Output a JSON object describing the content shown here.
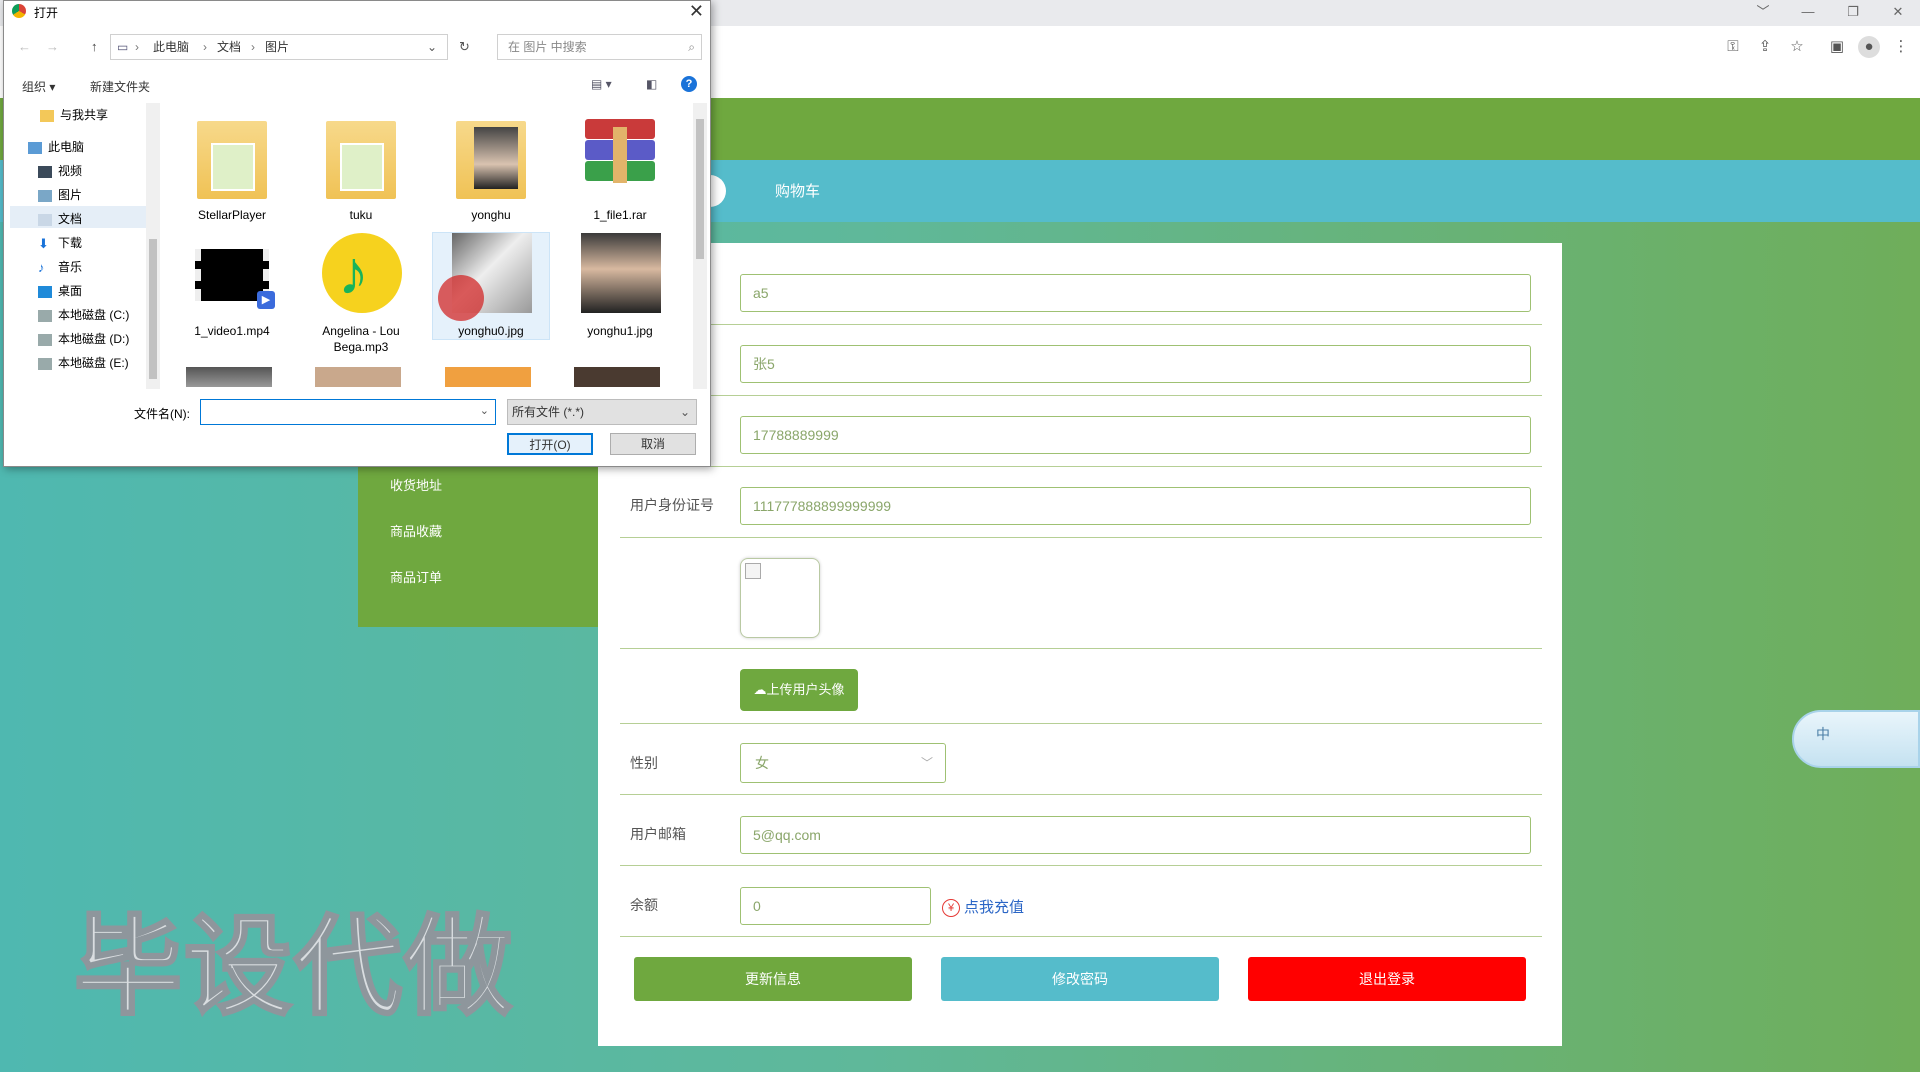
{
  "browser": {
    "window_controls": [
      "﹀",
      "—",
      "❐",
      "✕"
    ],
    "toolbar_icons": [
      "key-icon",
      "share-icon",
      "star-icon",
      "sidepanel-icon",
      "profile-icon",
      "menu-icon"
    ]
  },
  "page": {
    "nav": {
      "cart": "购物车"
    },
    "side_menu": [
      "收货地址",
      "商品收藏",
      "商品订单"
    ],
    "form": {
      "account_value": "a5",
      "name_value": "张5",
      "phone_value": "17788889999",
      "id_label": "用户身份证号",
      "id_value": "111777888899999999",
      "upload_label": "上传用户头像",
      "gender_label": "性别",
      "gender_value": "女",
      "email_label": "用户邮箱",
      "email_value": "5@qq.com",
      "balance_label": "余额",
      "balance_value": "0",
      "recharge_label": "点我充值",
      "recharge_icon": "¥"
    },
    "buttons": {
      "update": "更新信息",
      "change_password": "修改密码",
      "logout": "退出登录"
    },
    "colors": {
      "green": "#6fa83f",
      "teal": "#55bccb",
      "red": "#ff0000"
    },
    "watermark": "毕设代做",
    "ime_label": "中"
  },
  "dialog": {
    "title": "打开",
    "breadcrumb": [
      "此电脑",
      "文档",
      "图片"
    ],
    "search_placeholder": "在 图片 中搜索",
    "commands": {
      "organize": "组织 ▾",
      "new_folder": "新建文件夹"
    },
    "tree": [
      "与我共享",
      "此电脑",
      "视频",
      "图片",
      "文档",
      "下载",
      "音乐",
      "桌面",
      "本地磁盘 (C:)",
      "本地磁盘 (D:)",
      "本地磁盘 (E:)"
    ],
    "files": [
      {
        "name": "StellarPlayer"
      },
      {
        "name": "tuku"
      },
      {
        "name": "yonghu"
      },
      {
        "name": "1_file1.rar"
      },
      {
        "name": "1_video1.mp4"
      },
      {
        "name": "Angelina - Lou Bega.mp3"
      },
      {
        "name": "yonghu0.jpg"
      },
      {
        "name": "yonghu1.jpg"
      }
    ],
    "filename_label": "文件名(N):",
    "filename_value": "",
    "filetype": "所有文件 (*.*)",
    "open_button": "打开(O)",
    "cancel_button": "取消"
  }
}
